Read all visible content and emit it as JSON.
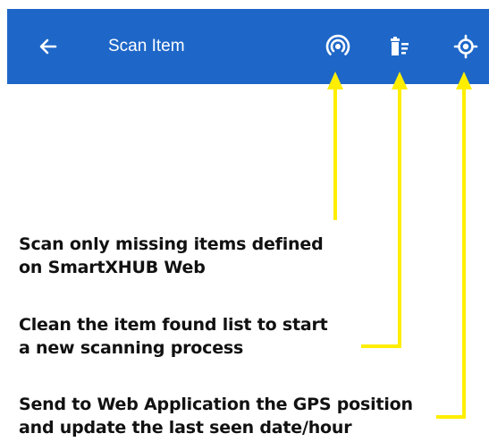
{
  "header": {
    "title": "Scan Item",
    "background_color": "#1e67c8",
    "icons": {
      "back": "arrow-left-icon",
      "missing_scan": "radar-signal-icon",
      "clear": "trash-list-icon",
      "gps": "gps-target-icon"
    }
  },
  "annotations": {
    "arrow_color": "#ffee00",
    "missing_scan": "Scan only missing items defined\non SmartXHUB Web",
    "clear_list": "Clean the item found list to start\na new scanning process",
    "gps_update": "Send to Web Application the GPS position\nand update the last seen date/hour"
  }
}
